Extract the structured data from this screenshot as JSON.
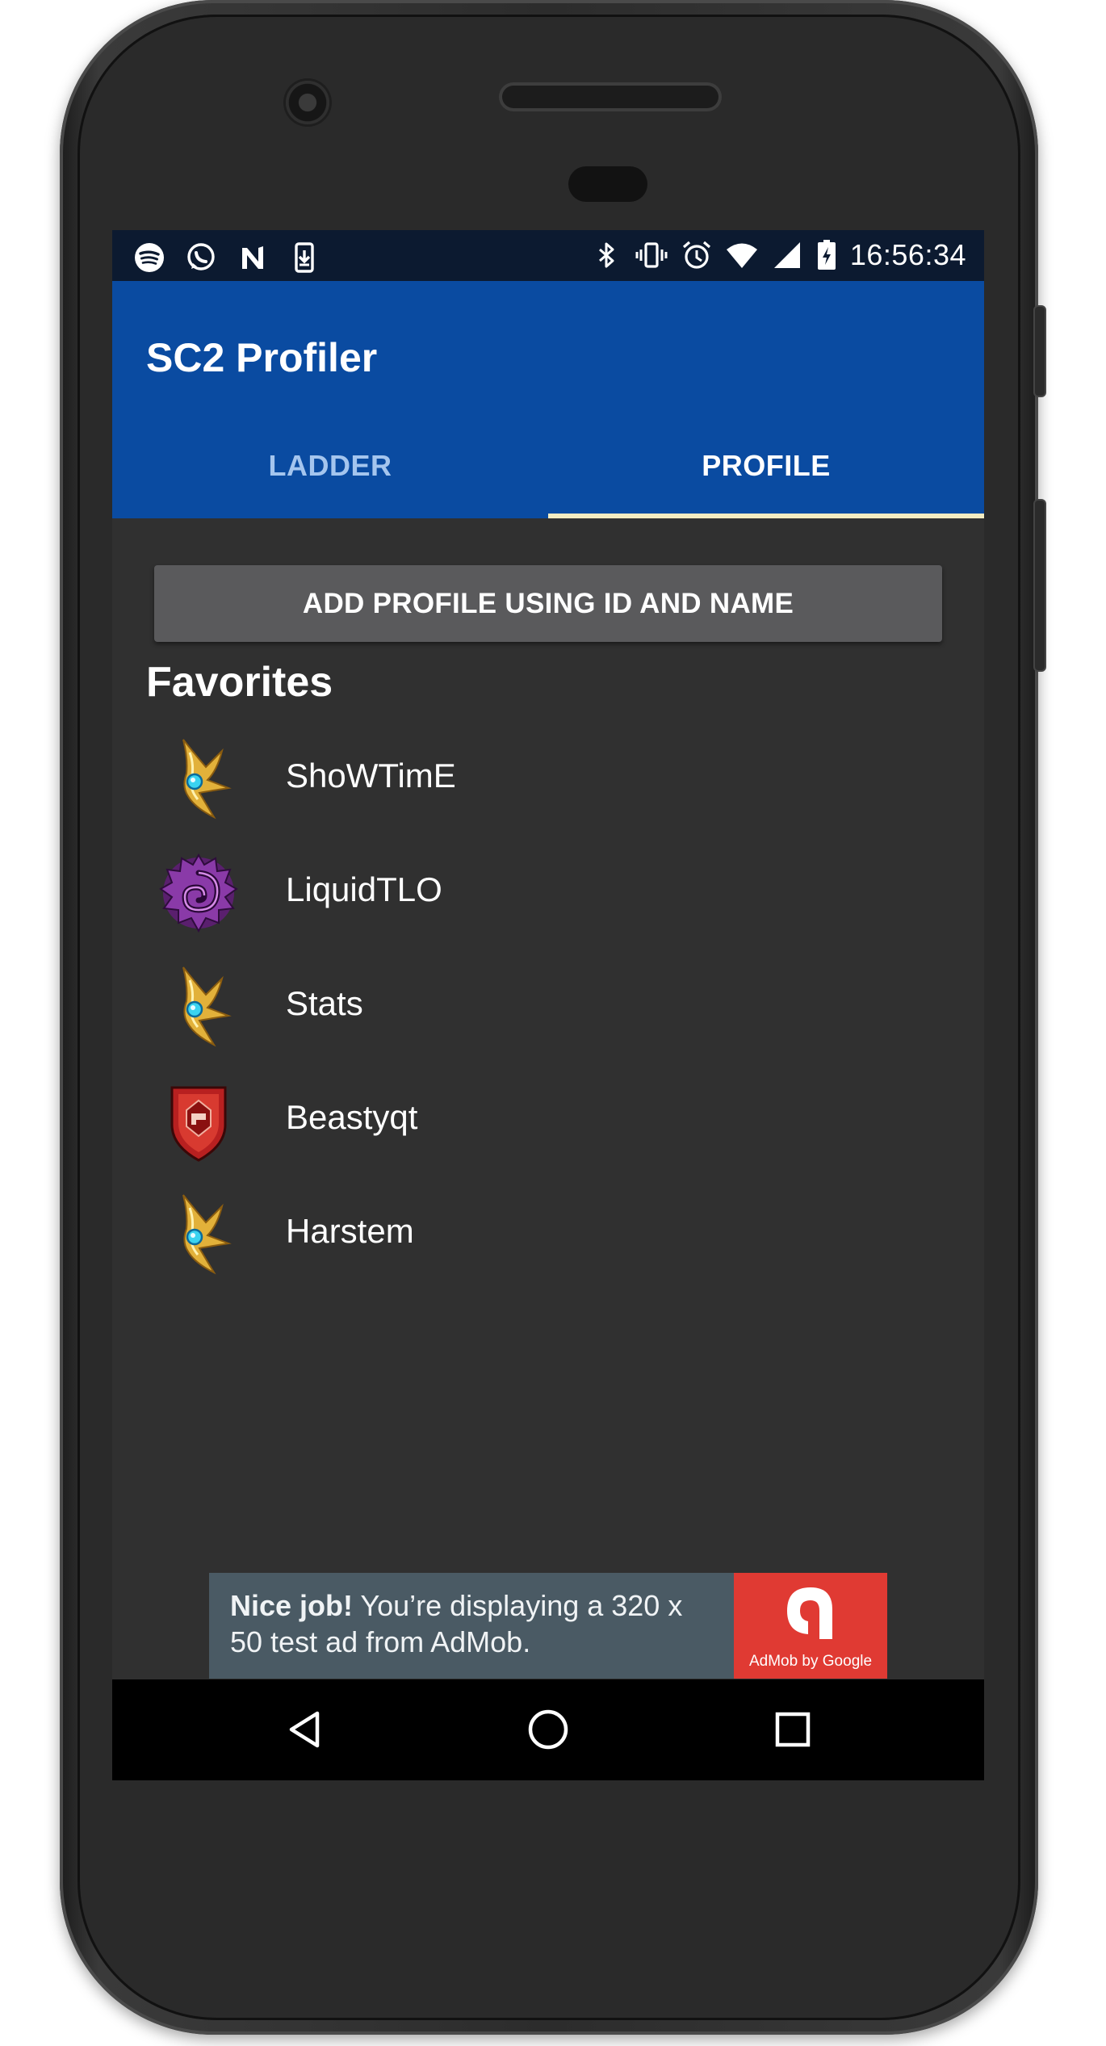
{
  "status_bar": {
    "time": "16:56:34",
    "left_icons": [
      "spotify-icon",
      "whatsapp-icon",
      "n-app-icon",
      "download-icon"
    ],
    "right_icons": [
      "bluetooth-icon",
      "vibrate-icon",
      "alarm-icon",
      "wifi-icon",
      "signal-icon",
      "battery-charging-icon"
    ]
  },
  "app_bar": {
    "title": "SC2 Profiler",
    "tabs": [
      {
        "label": "LADDER",
        "selected": false
      },
      {
        "label": "PROFILE",
        "selected": true
      }
    ]
  },
  "main": {
    "add_button_label": "ADD PROFILE USING ID AND NAME",
    "favorites_title": "Favorites",
    "favorites": [
      {
        "name": "ShoWTimE",
        "race_icon": "protoss-icon"
      },
      {
        "name": "LiquidTLO",
        "race_icon": "zerg-icon"
      },
      {
        "name": "Stats",
        "race_icon": "protoss-icon"
      },
      {
        "name": "Beastyqt",
        "race_icon": "terran-icon"
      },
      {
        "name": "Harstem",
        "race_icon": "protoss-icon"
      }
    ]
  },
  "ad_banner": {
    "bold_text": "Nice job!",
    "text": "You’re displaying a 320 x 50 test ad from AdMob.",
    "logo_caption": "AdMob by Google"
  },
  "nav_bar": {
    "buttons": [
      "back-icon",
      "home-icon",
      "recents-icon"
    ]
  },
  "colors": {
    "app_bar": "#0a4ba1",
    "status_bar": "#0c1a30",
    "background": "#303030",
    "tab_indicator": "#f3ecc2",
    "inactive_tab": "#a4c5ee",
    "button": "#5a5a5c",
    "ad_background": "#4a5a64",
    "ad_logo": "#e03a33"
  }
}
